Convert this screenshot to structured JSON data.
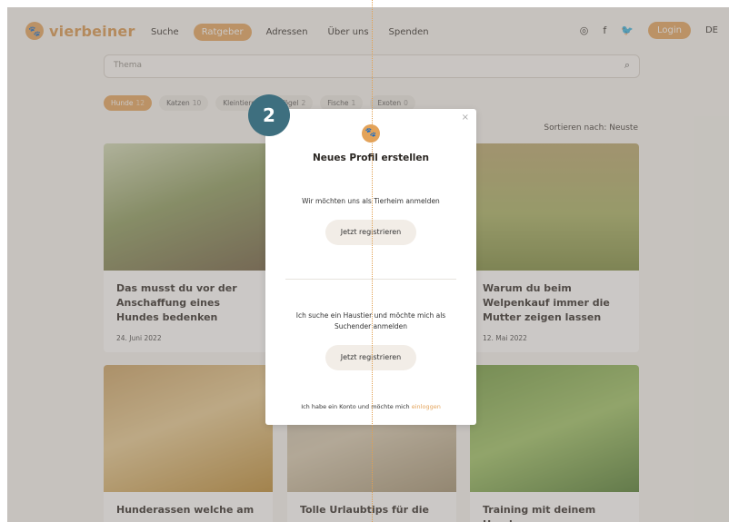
{
  "brand": {
    "name": "vierbeiner"
  },
  "nav": {
    "items": [
      "Suche",
      "Ratgeber",
      "Adressen",
      "Über uns",
      "Spenden"
    ],
    "active_index": 1,
    "login": "Login",
    "lang": "DE",
    "social_icons": [
      "instagram-icon",
      "facebook-icon",
      "twitter-icon"
    ]
  },
  "search": {
    "placeholder": "Thema"
  },
  "chips": [
    {
      "label": "Hunde",
      "count": "12"
    },
    {
      "label": "Katzen",
      "count": "10"
    },
    {
      "label": "Kleintiere",
      "count": ""
    },
    {
      "label": "Vögel",
      "count": "2"
    },
    {
      "label": "Fische",
      "count": "1"
    },
    {
      "label": "Exoten",
      "count": "0"
    }
  ],
  "sort": {
    "label": "Sortieren nach:",
    "value": "Neuste"
  },
  "cards": [
    {
      "title": "Das musst du vor der Anschaffung eines Hundes bedenken",
      "date": "24. Juni 2022"
    },
    {
      "title": "",
      "date": ""
    },
    {
      "title": "Warum du beim Welpenkauf immer die Mutter zeigen lassen",
      "date": "12. Mai 2022"
    },
    {
      "title": "Hunderassen welche am",
      "date": ""
    },
    {
      "title": "Tolle Urlaubtips für die",
      "date": ""
    },
    {
      "title": "Training mit deinem Hund:",
      "date": ""
    }
  ],
  "modal": {
    "title": "Neues Profil erstellen",
    "shelter_text": "Wir möchten uns als Tierheim anmelden",
    "register1": "Jetzt registrieren",
    "seeker_text": "Ich suche ein Haustier und möchte mich als Suchender anmelden",
    "register2": "Jetzt registrieren",
    "footer_text": "Ich habe ein Konto und möchte mich",
    "footer_link": "einloggen"
  },
  "step_badge": "2",
  "colors": {
    "accent": "#e3a35a",
    "badge": "#3e6f7f",
    "overlay": "rgba(130,125,118,0.42)"
  }
}
